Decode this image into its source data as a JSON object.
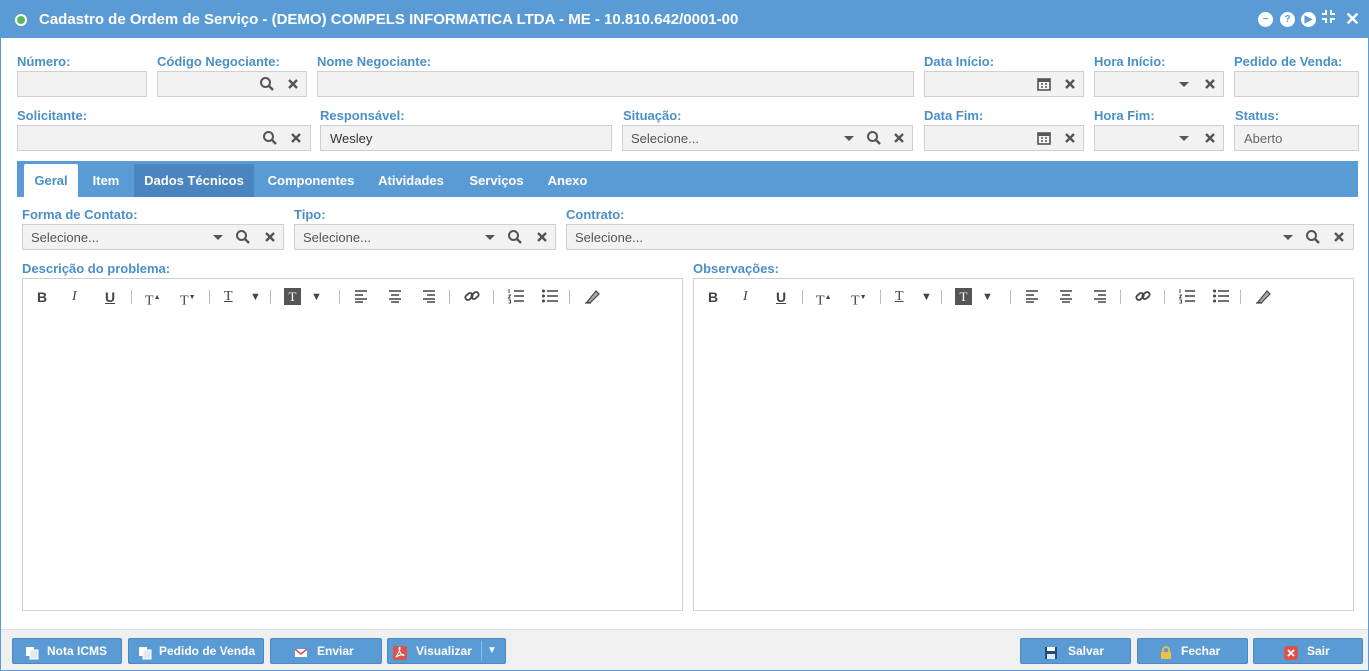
{
  "window": {
    "title": "Cadastro de Ordem de Serviço - (DEMO) COMPELS INFORMATICA LTDA - ME - 10.810.642/0001-00",
    "controls": [
      "minimize-icon",
      "help-icon",
      "next-icon",
      "collapse-icon",
      "close-icon"
    ]
  },
  "form": {
    "numero": {
      "label": "Número:",
      "value": ""
    },
    "codigo_negociante": {
      "label": "Código Negociante:",
      "value": ""
    },
    "nome_negociante": {
      "label": "Nome Negociante:",
      "value": ""
    },
    "data_inicio": {
      "label": "Data Início:",
      "value": ""
    },
    "hora_inicio": {
      "label": "Hora Início:",
      "value": ""
    },
    "pedido_venda": {
      "label": "Pedido de Venda:",
      "value": ""
    },
    "solicitante": {
      "label": "Solicitante:",
      "value": ""
    },
    "responsavel": {
      "label": "Responsável:",
      "value": "Wesley"
    },
    "situacao": {
      "label": "Situação:",
      "placeholder": "Selecione..."
    },
    "data_fim": {
      "label": "Data Fim:",
      "value": ""
    },
    "hora_fim": {
      "label": "Hora Fim:",
      "value": ""
    },
    "status": {
      "label": "Status:",
      "value": "Aberto"
    }
  },
  "tabs": [
    {
      "label": "Geral",
      "active": true
    },
    {
      "label": "Item"
    },
    {
      "label": "Dados Técnicos",
      "hover": true
    },
    {
      "label": "Componentes"
    },
    {
      "label": "Atividades"
    },
    {
      "label": "Serviços"
    },
    {
      "label": "Anexo"
    }
  ],
  "geral": {
    "forma_contato": {
      "label": "Forma de Contato:",
      "placeholder": "Selecione..."
    },
    "tipo": {
      "label": "Tipo:",
      "placeholder": "Selecione..."
    },
    "contrato": {
      "label": "Contrato:",
      "placeholder": "Selecione..."
    },
    "descricao": {
      "label": "Descrição do problema:",
      "value": ""
    },
    "observacoes": {
      "label": "Observações:",
      "value": ""
    }
  },
  "editor_toolbar": {
    "bold": "B",
    "italic": "I",
    "underline": "U",
    "superscript": "T",
    "subscript": "T",
    "text_color": "T",
    "background_color": "T"
  },
  "footer": {
    "nota_icms": "Nota ICMS",
    "pedido_venda": "Pedido de Venda",
    "enviar": "Enviar",
    "visualizar": "Visualizar",
    "salvar": "Salvar",
    "fechar": "Fechar",
    "sair": "Sair"
  },
  "colors": {
    "primary": "#5b9bd5",
    "label": "#4a90c8",
    "field_bg": "#f2f2f2",
    "danger": "#d9534f"
  }
}
